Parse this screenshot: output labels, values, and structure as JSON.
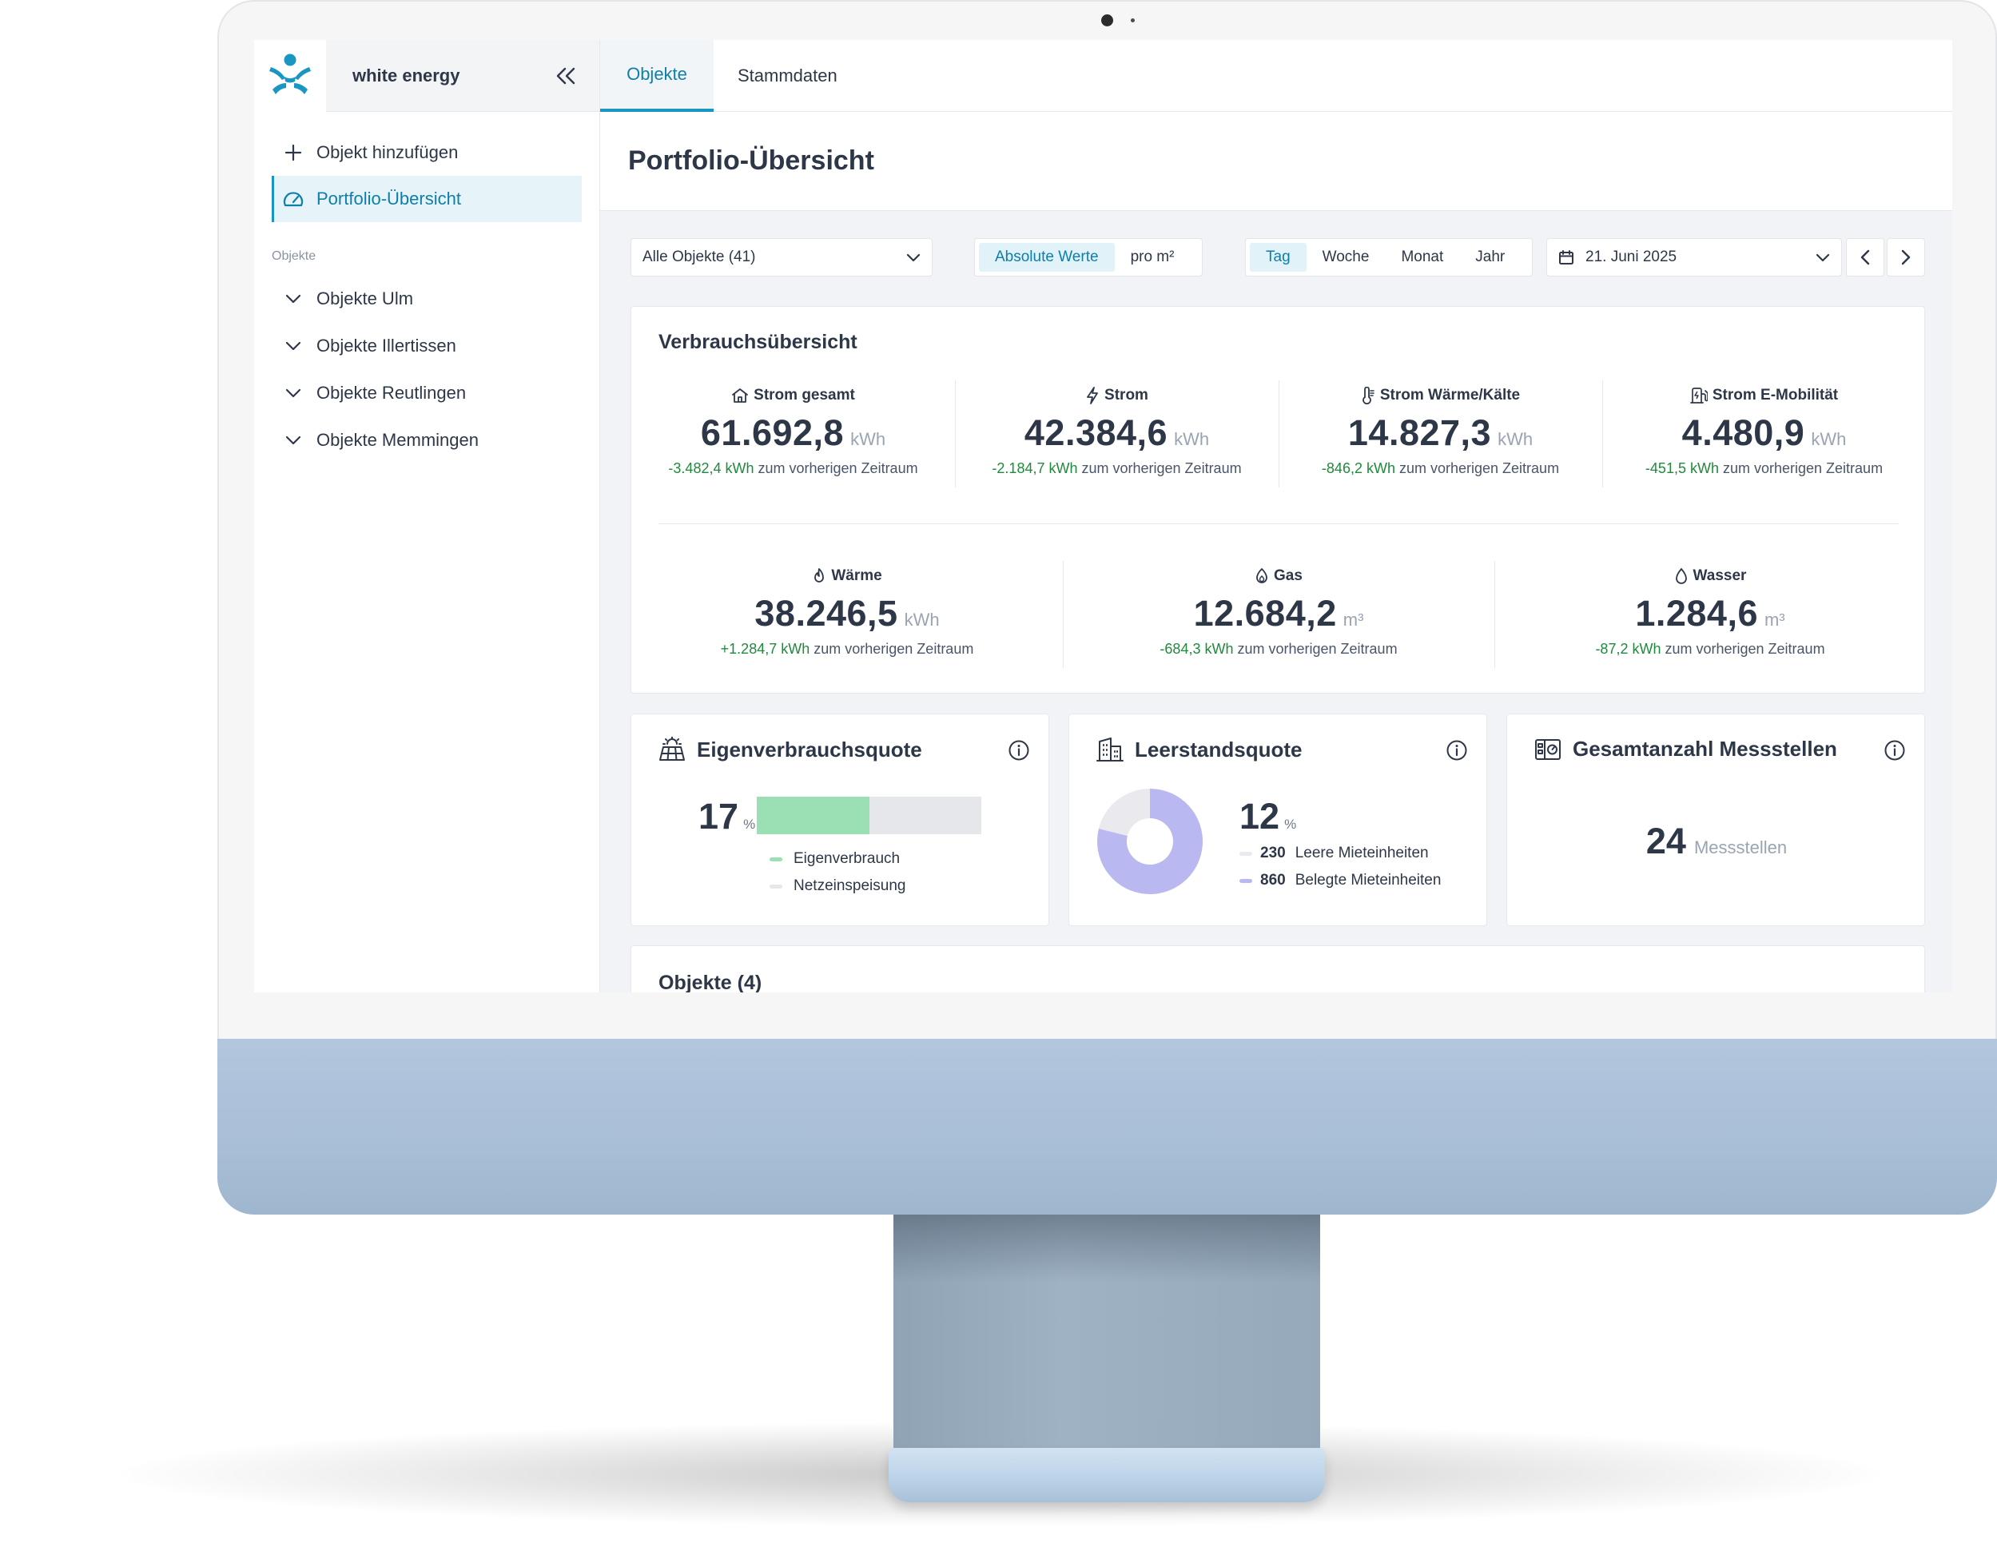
{
  "app": {
    "brand": "white energy"
  },
  "tabs": [
    {
      "label": "Objekte",
      "active": true
    },
    {
      "label": "Stammdaten",
      "active": false
    }
  ],
  "sidebar": {
    "add_label": "Objekt hinzufügen",
    "portfolio_label": "Portfolio-Übersicht",
    "section_label": "Objekte",
    "groups": [
      "Objekte Ulm",
      "Objekte Illertissen",
      "Objekte Reutlingen",
      "Objekte Memmingen"
    ]
  },
  "page": {
    "title": "Portfolio-Übersicht"
  },
  "filters": {
    "object_select": "Alle Objekte (41)",
    "value_modes": [
      "Absolute Werte",
      "pro m²"
    ],
    "value_mode_active": "Absolute Werte",
    "periods": [
      "Tag",
      "Woche",
      "Monat",
      "Jahr"
    ],
    "period_active": "Tag",
    "date": "21. Juni 2025"
  },
  "consumption": {
    "title": "Verbrauchsübersicht",
    "delta_suffix": "zum vorherigen Zeitraum",
    "row1": [
      {
        "label": "Strom gesamt",
        "icon": "house-icon",
        "value": "61.692,8",
        "unit": "kWh",
        "delta": "-3.482,4 kWh"
      },
      {
        "label": "Strom",
        "icon": "lightning-icon",
        "value": "42.384,6",
        "unit": "kWh",
        "delta": "-2.184,7 kWh"
      },
      {
        "label": "Strom Wärme/Kälte",
        "icon": "thermometer-icon",
        "value": "14.827,3",
        "unit": "kWh",
        "delta": "-846,2 kWh"
      },
      {
        "label": "Strom E-Mobilität",
        "icon": "ev-charger-icon",
        "value": "4.480,9",
        "unit": "kWh",
        "delta": "-451,5 kWh"
      }
    ],
    "row2": [
      {
        "label": "Wärme",
        "icon": "flame-icon",
        "value": "38.246,5",
        "unit": "kWh",
        "delta": "+1.284,7 kWh"
      },
      {
        "label": "Gas",
        "icon": "gas-icon",
        "value": "12.684,2",
        "unit": "m³",
        "delta": "-684,3 kWh"
      },
      {
        "label": "Wasser",
        "icon": "water-drop-icon",
        "value": "1.284,6",
        "unit": "m³",
        "delta": "-87,2 kWh"
      }
    ]
  },
  "self_consumption": {
    "title": "Eigenverbrauchsquote",
    "value": "17",
    "unit": "%",
    "fraction": 0.5,
    "legend": [
      "Eigenverbrauch",
      "Netzeinspeisung"
    ],
    "colors": {
      "fill": "#9be0b4",
      "track": "#e5e7ea"
    }
  },
  "vacancy": {
    "title": "Leerstandsquote",
    "value": "12",
    "unit": "%",
    "empty_count": "230",
    "empty_label": "Leere Mieteinheiten",
    "occupied_count": "860",
    "occupied_label": "Belegte Mieteinheiten",
    "colors": {
      "occupied": "#bab8f0",
      "empty": "#e9e9ee"
    }
  },
  "meters": {
    "title": "Gesamtanzahl Messstellen",
    "value": "24",
    "unit": "Messstellen"
  },
  "objects": {
    "title": "Objekte (4)"
  },
  "colors": {
    "accent": "#1a96c3",
    "positive_delta": "#1f8a3c",
    "text": "#2d3748"
  }
}
